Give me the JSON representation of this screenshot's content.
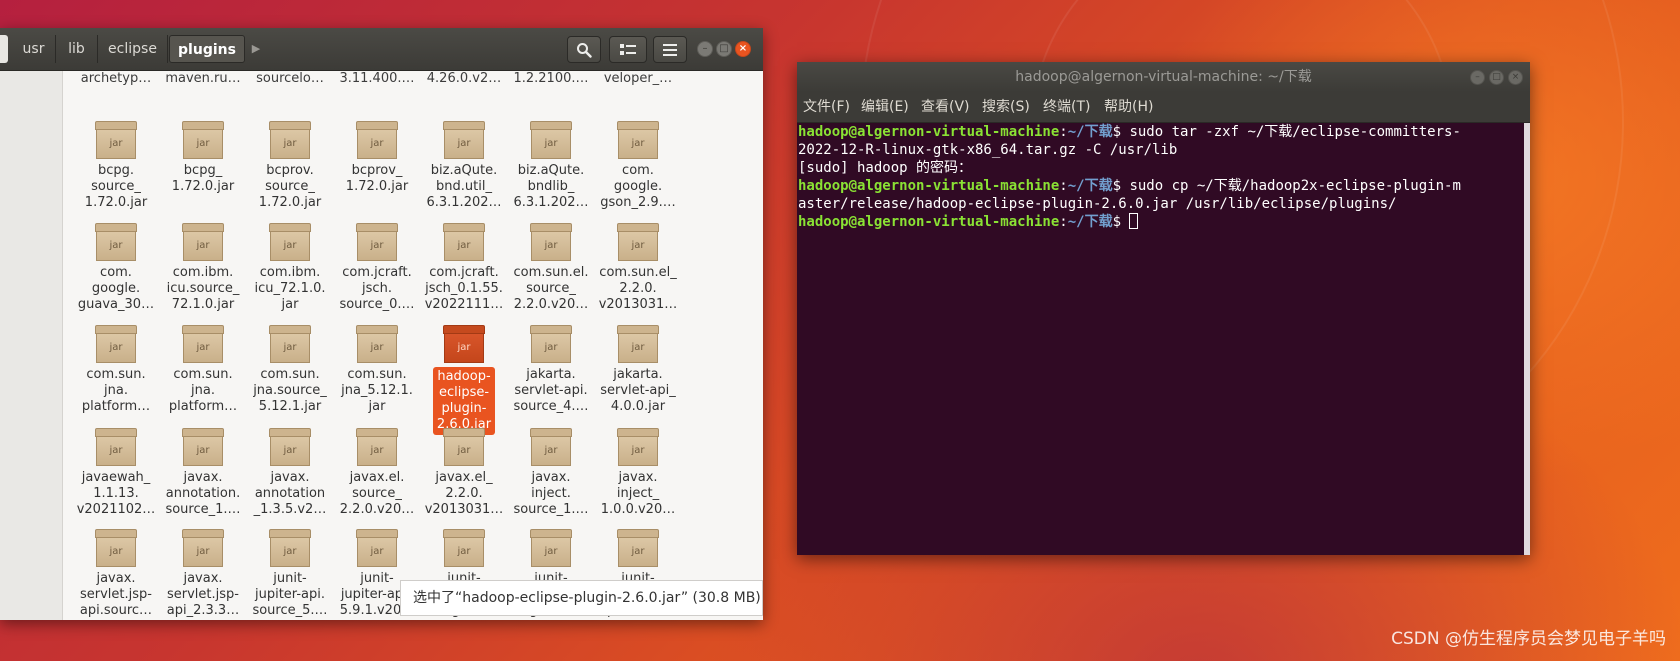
{
  "file_manager": {
    "breadcrumbs": [
      "usr",
      "lib",
      "eclipse",
      "plugins"
    ],
    "search_icon": "search-icon",
    "view_icon": "list-view-icon",
    "menu_icon": "hamburger-menu-icon",
    "top_row": [
      "archetyp…",
      "maven.ru…",
      "sourcelo…",
      "3.11.400.…",
      "4.26.0.v2…",
      "1.2.2100.…",
      "veloper_…"
    ],
    "files": [
      "bcpg.\nsource_\n1.72.0.jar",
      "bcpg_\n1.72.0.jar",
      "bcprov.\nsource_\n1.72.0.jar",
      "bcprov_\n1.72.0.jar",
      "biz.aQute.\nbnd.util_\n6.3.1.202…",
      "biz.aQute.\nbndlib_\n6.3.1.202…",
      "com.\ngoogle.\ngson_2.9.…",
      "com.\ngoogle.\nguava_30…",
      "com.ibm.\nicu.source_\n72.1.0.jar",
      "com.ibm.\nicu_72.1.0.\njar",
      "com.jcraft.\njsch.\nsource_0.…",
      "com.jcraft.\njsch_0.1.55.\nv2022111…",
      "com.sun.el.\nsource_\n2.2.0.v20…",
      "com.sun.el_\n2.2.0.\nv2013031…",
      "com.sun.\njna.\nplatform…",
      "com.sun.\njna.\nplatform…",
      "com.sun.\njna.source_\n5.12.1.jar",
      "com.sun.\njna_5.12.1.\njar",
      "hadoop-\neclipse-\nplugin-\n2.6.0.jar",
      "jakarta.\nservlet-api.\nsource_4.…",
      "jakarta.\nservlet-api_\n4.0.0.jar",
      "javaewah_\n1.1.13.\nv2021102…",
      "javax.\nannotation.\nsource_1.…",
      "javax.\nannotation\n_1.3.5.v2…",
      "javax.el.\nsource_\n2.2.0.v20…",
      "javax.el_\n2.2.0.\nv2013031…",
      "javax.\ninject.\nsource_1.…",
      "javax.\ninject_\n1.0.0.v20…",
      "javax.\nservlet.jsp-\napi.sourc…",
      "javax.\nservlet.jsp-\napi_2.3.3…",
      "junit-\njupiter-api.\nsource_5.…",
      "junit-\njupiter-api_\n5.9.1.v20…",
      "junit-\njupiter-\nengine…",
      "junit-\njupiter-\nmigration…",
      "junit-\njupiter-\nparams…"
    ],
    "selected_index": 18,
    "jar_label": "jar",
    "status": "选中了“hadoop-eclipse-plugin-2.6.0.jar” (30.8 MB)"
  },
  "terminal": {
    "title": "hadoop@algernon-virtual-machine: ~/下载",
    "menu": [
      "文件(F)",
      "编辑(E)",
      "查看(V)",
      "搜索(S)",
      "终端(T)",
      "帮助(H)"
    ],
    "prompt_user": "hadoop@algernon-virtual-machine",
    "prompt_path": "~/下载",
    "cmd1_a": "$ sudo tar -zxf ~/下载/eclipse-committers-",
    "cmd1_b": "2022-12-R-linux-gtk-x86_64.tar.gz -C /usr/lib",
    "sudo_line": "[sudo] hadoop 的密码：",
    "cmd2_a": "$ sudo cp ~/下载/hadoop2x-eclipse-plugin-m",
    "cmd2_b": "aster/release/hadoop-eclipse-plugin-2.6.0.jar /usr/lib/eclipse/plugins/",
    "prompt_end": "$ "
  },
  "watermark": "CSDN @仿生程序员会梦见电子羊吗",
  "colors": {
    "accent": "#e95420",
    "terminal_bg": "#300a24",
    "prompt_user": "#8ae234",
    "prompt_path": "#729fcf"
  }
}
